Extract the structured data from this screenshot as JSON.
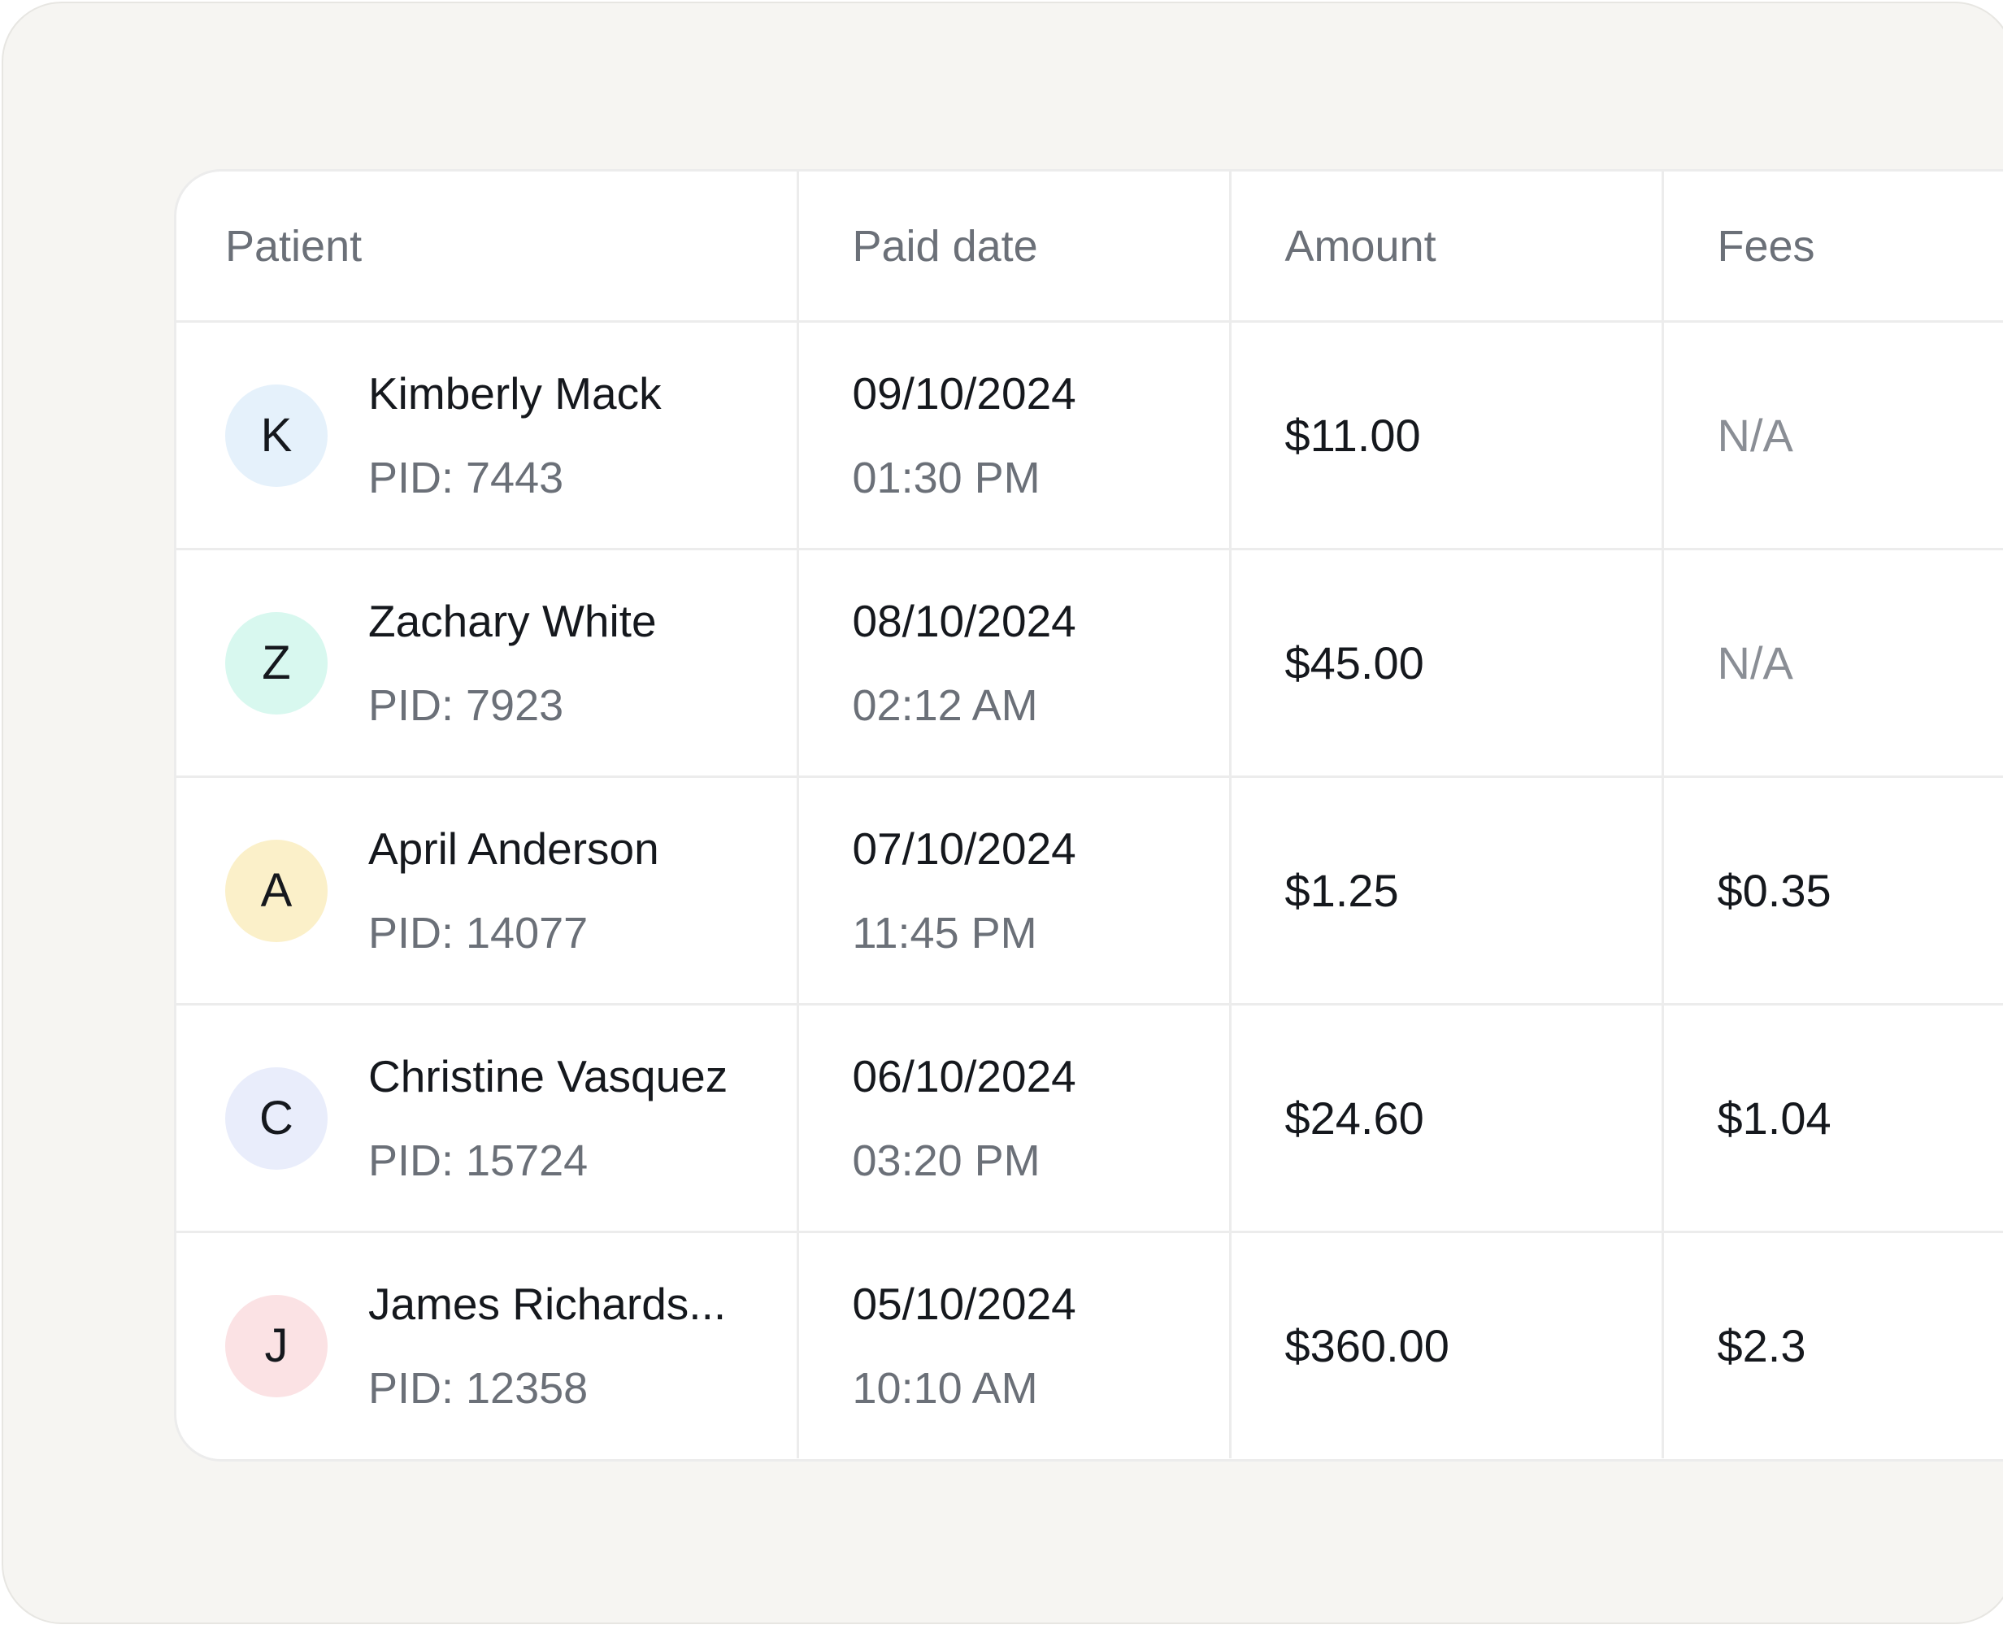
{
  "table": {
    "headers": {
      "patient": "Patient",
      "paid_date": "Paid date",
      "amount": "Amount",
      "fees": "Fees"
    },
    "rows": [
      {
        "initial": "K",
        "avatar_color": "#e5f1fb",
        "name": "Kimberly Mack",
        "pid": "PID: 7443",
        "date": "09/10/2024",
        "time": "01:30 PM",
        "amount": "$11.00",
        "fees": "N/A"
      },
      {
        "initial": "Z",
        "avatar_color": "#d8f8ef",
        "name": "Zachary White",
        "pid": "PID: 7923",
        "date": "08/10/2024",
        "time": "02:12 AM",
        "amount": "$45.00",
        "fees": "N/A"
      },
      {
        "initial": "A",
        "avatar_color": "#fbf0c9",
        "name": "April Anderson",
        "pid": "PID: 14077",
        "date": "07/10/2024",
        "time": "11:45 PM",
        "amount": "$1.25",
        "fees": "$0.35"
      },
      {
        "initial": "C",
        "avatar_color": "#e9edfb",
        "name": "Christine Vasquez",
        "pid": "PID: 15724",
        "date": "06/10/2024",
        "time": "03:20 PM",
        "amount": "$24.60",
        "fees": "$1.04"
      },
      {
        "initial": "J",
        "avatar_color": "#fbe2e4",
        "name": "James Richards...",
        "pid": "PID: 12358",
        "date": "05/10/2024",
        "time": "10:10 AM",
        "amount": "$360.00",
        "fees": "$2.3"
      }
    ]
  }
}
